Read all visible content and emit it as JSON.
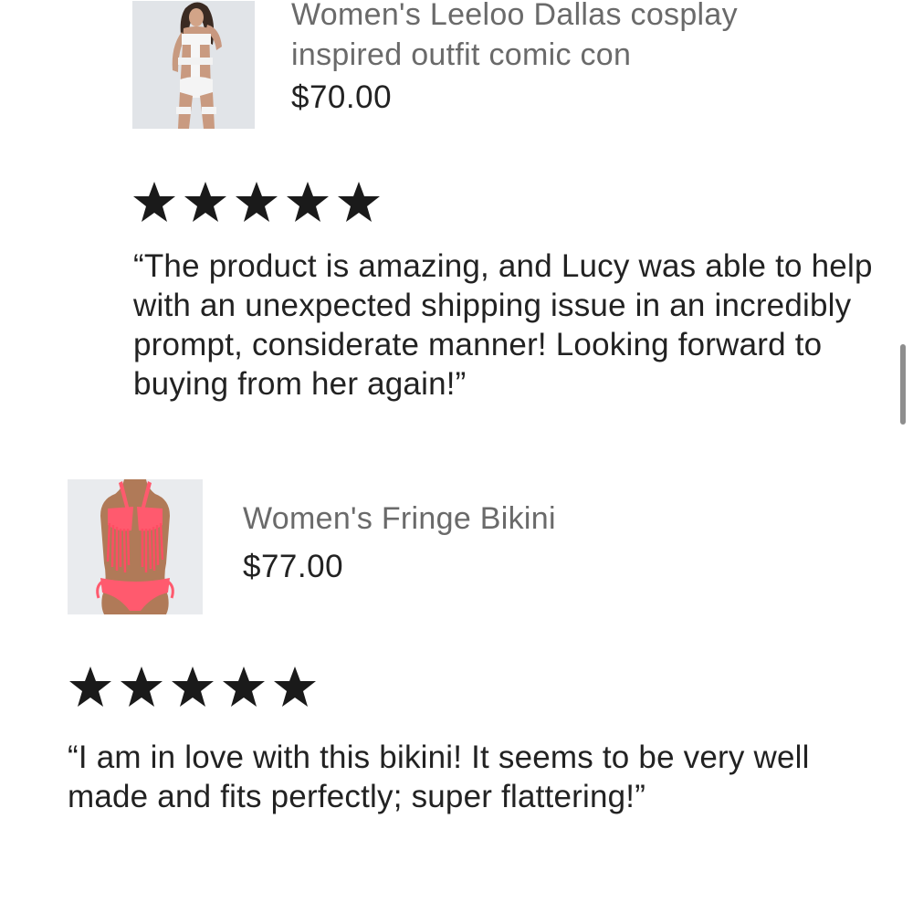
{
  "items": [
    {
      "title": "Women's Leeloo Dallas cosplay inspired outfit comic con",
      "price": "$70.00",
      "image_icon": "white-bandage-outfit-photo",
      "rating": 5,
      "review": "“The product is amazing, and Lucy was able to help with an unexpected shipping issue in an incredibly prompt, considerate manner! Looking forward to buying from her again!”"
    },
    {
      "title": "Women's Fringe Bikini",
      "price": "$77.00",
      "image_icon": "coral-fringe-bikini-photo",
      "rating": 5,
      "review": "“I am in love with this bikini!  It seems to be very well made and fits perfectly; super flattering!”"
    }
  ],
  "colors": {
    "star": "#1a1a1a",
    "title_text": "#6a6a6a",
    "body_text": "#222222",
    "scrollbar": "#8e8e8e",
    "bikini_coral": "#ff5a6e"
  }
}
